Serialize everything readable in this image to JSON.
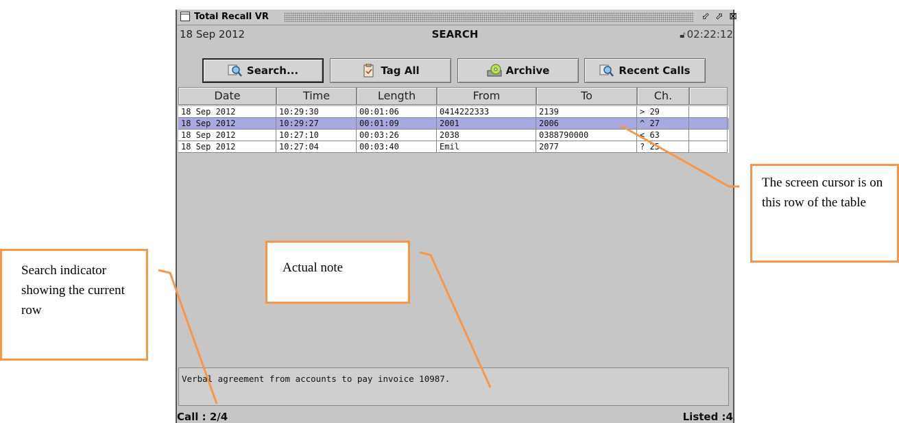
{
  "window": {
    "title": "Total Recall VR",
    "title_icon": "window-icon",
    "controls": {
      "minimize_icon": "minimize-icon",
      "maximize_icon": "maximize-icon",
      "close_icon": "close-icon"
    }
  },
  "info_bar": {
    "date": "18 Sep 2012",
    "mode": "SEARCH",
    "time": "02:22:12",
    "lock_icon": "lock-icon"
  },
  "toolbar": {
    "search_label": "Search...",
    "tag_all_label": "Tag All",
    "archive_label": "Archive",
    "recent_calls_label": "Recent Calls"
  },
  "table": {
    "columns": [
      "Date",
      "Time",
      "Length",
      "From",
      "To",
      "Ch.",
      ""
    ],
    "rows": [
      {
        "date": "18 Sep 2012",
        "time": "10:29:30",
        "length": "00:01:06",
        "from": "0414222333",
        "to": "2139",
        "ch": "> 29"
      },
      {
        "date": "18 Sep 2012",
        "time": "10:29:27",
        "length": "00:01:09",
        "from": "2001",
        "to": "2006",
        "ch": "^ 27"
      },
      {
        "date": "18 Sep 2012",
        "time": "10:27:10",
        "length": "00:03:26",
        "from": "2038",
        "to": "0388790000",
        "ch": "< 63"
      },
      {
        "date": "18 Sep 2012",
        "time": "10:27:04",
        "length": "00:03:40",
        "from": "Emil",
        "to": "2077",
        "ch": "? 25"
      }
    ],
    "selected_row": 2,
    "selection_color": "#a9a9e2"
  },
  "note": "Verbal agreement from accounts to pay invoice 10987.",
  "status": {
    "call_position": "Call : 2/4",
    "listed": "Listed :4"
  },
  "callouts": {
    "cursor": "The screen cursor is on this row of the table",
    "note": "Actual note",
    "search_indicator": "Search indicator showing the current row",
    "color": "#f79646"
  }
}
